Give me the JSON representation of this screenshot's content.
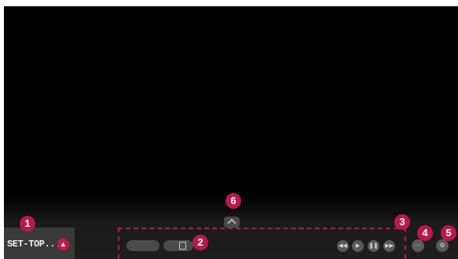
{
  "input": {
    "label": "SET-TOP..."
  },
  "controls": {
    "media_icons": [
      "rewind-icon",
      "play-icon",
      "pause-icon",
      "fast-forward-icon"
    ]
  },
  "callouts": [
    "1",
    "2",
    "3",
    "4",
    "5",
    "6"
  ],
  "colors": {
    "callout": "#b8194d",
    "dashed_outline": "#b01c4e",
    "input_arrow": "#c8174c"
  }
}
